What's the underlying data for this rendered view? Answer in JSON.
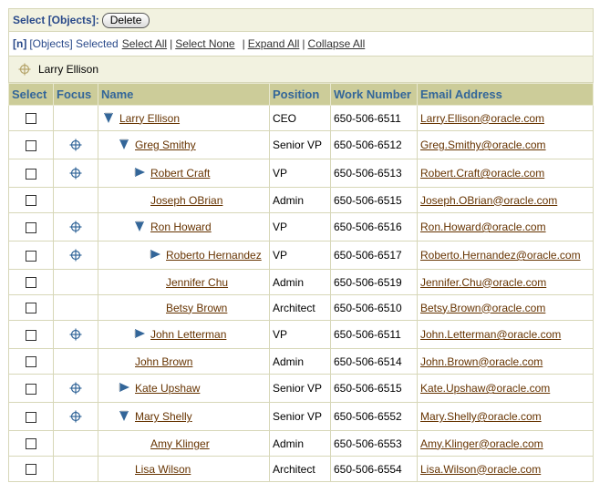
{
  "select_bar": {
    "label": "Select [Objects]:",
    "delete_label": "Delete"
  },
  "link_bar": {
    "count": "[n]",
    "selected_text": "[Objects] Selected",
    "select_all": "Select All",
    "select_none": "Select None",
    "expand_all": "Expand All",
    "collapse_all": "Collapse All"
  },
  "breadcrumb": {
    "current": "Larry Ellison"
  },
  "table": {
    "headers": [
      "Select",
      "Focus",
      "Name",
      "Position",
      "Work Number",
      "Email Address"
    ],
    "rows": [
      {
        "name": "Larry Ellison",
        "position": "CEO",
        "work": "650-506-6511",
        "email": "Larry.Ellison@oracle.com",
        "level": 0,
        "twisty": "expanded",
        "focus": false
      },
      {
        "name": "Greg Smithy",
        "position": "Senior VP",
        "work": "650-506-6512",
        "email": "Greg.Smithy@oracle.com",
        "level": 1,
        "twisty": "expanded",
        "focus": true
      },
      {
        "name": "Robert Craft",
        "position": "VP",
        "work": "650-506-6513",
        "email": "Robert.Craft@oracle.com",
        "level": 2,
        "twisty": "collapsed",
        "focus": true
      },
      {
        "name": "Joseph OBrian",
        "position": "Admin",
        "work": "650-506-6515",
        "email": "Joseph.OBrian@oracle.com",
        "level": 2,
        "twisty": "none",
        "focus": false
      },
      {
        "name": "Ron Howard",
        "position": "VP",
        "work": "650-506-6516",
        "email": "Ron.Howard@oracle.com",
        "level": 2,
        "twisty": "expanded",
        "focus": true
      },
      {
        "name": "Roberto Hernandez",
        "position": "VP",
        "work": "650-506-6517",
        "email": "Roberto.Hernandez@oracle.com",
        "level": 3,
        "twisty": "collapsed",
        "focus": true
      },
      {
        "name": "Jennifer Chu",
        "position": "Admin",
        "work": "650-506-6519",
        "email": "Jennifer.Chu@oracle.com",
        "level": 3,
        "twisty": "none",
        "focus": false
      },
      {
        "name": "Betsy Brown",
        "position": "Architect",
        "work": "650-506-6510",
        "email": "Betsy.Brown@oracle.com",
        "level": 3,
        "twisty": "none",
        "focus": false
      },
      {
        "name": "John Letterman",
        "position": "VP",
        "work": "650-506-6511",
        "email": "John.Letterman@oracle.com",
        "level": 2,
        "twisty": "collapsed",
        "focus": true
      },
      {
        "name": "John Brown",
        "position": "Admin",
        "work": "650-506-6514",
        "email": "John.Brown@oracle.com",
        "level": 1,
        "twisty": "none",
        "focus": false
      },
      {
        "name": "Kate Upshaw",
        "position": "Senior VP",
        "work": "650-506-6515",
        "email": "Kate.Upshaw@oracle.com",
        "level": 1,
        "twisty": "collapsed",
        "focus": true
      },
      {
        "name": "Mary Shelly",
        "position": "Senior VP",
        "work": "650-506-6552",
        "email": "Mary.Shelly@oracle.com",
        "level": 1,
        "twisty": "expanded",
        "focus": true
      },
      {
        "name": "Amy Klinger",
        "position": "Admin",
        "work": "650-506-6553",
        "email": "Amy.Klinger@oracle.com",
        "level": 2,
        "twisty": "none",
        "focus": false
      },
      {
        "name": "Lisa Wilson",
        "position": "Architect",
        "work": "650-506-6554",
        "email": "Lisa.Wilson@oracle.com",
        "level": 1,
        "twisty": "none",
        "focus": false
      }
    ]
  },
  "colors": {
    "header_bg": "#cccc99",
    "header_text": "#336699",
    "link": "#663300",
    "bar_bg": "#f2f2e0",
    "icon_blue": "#336699"
  }
}
